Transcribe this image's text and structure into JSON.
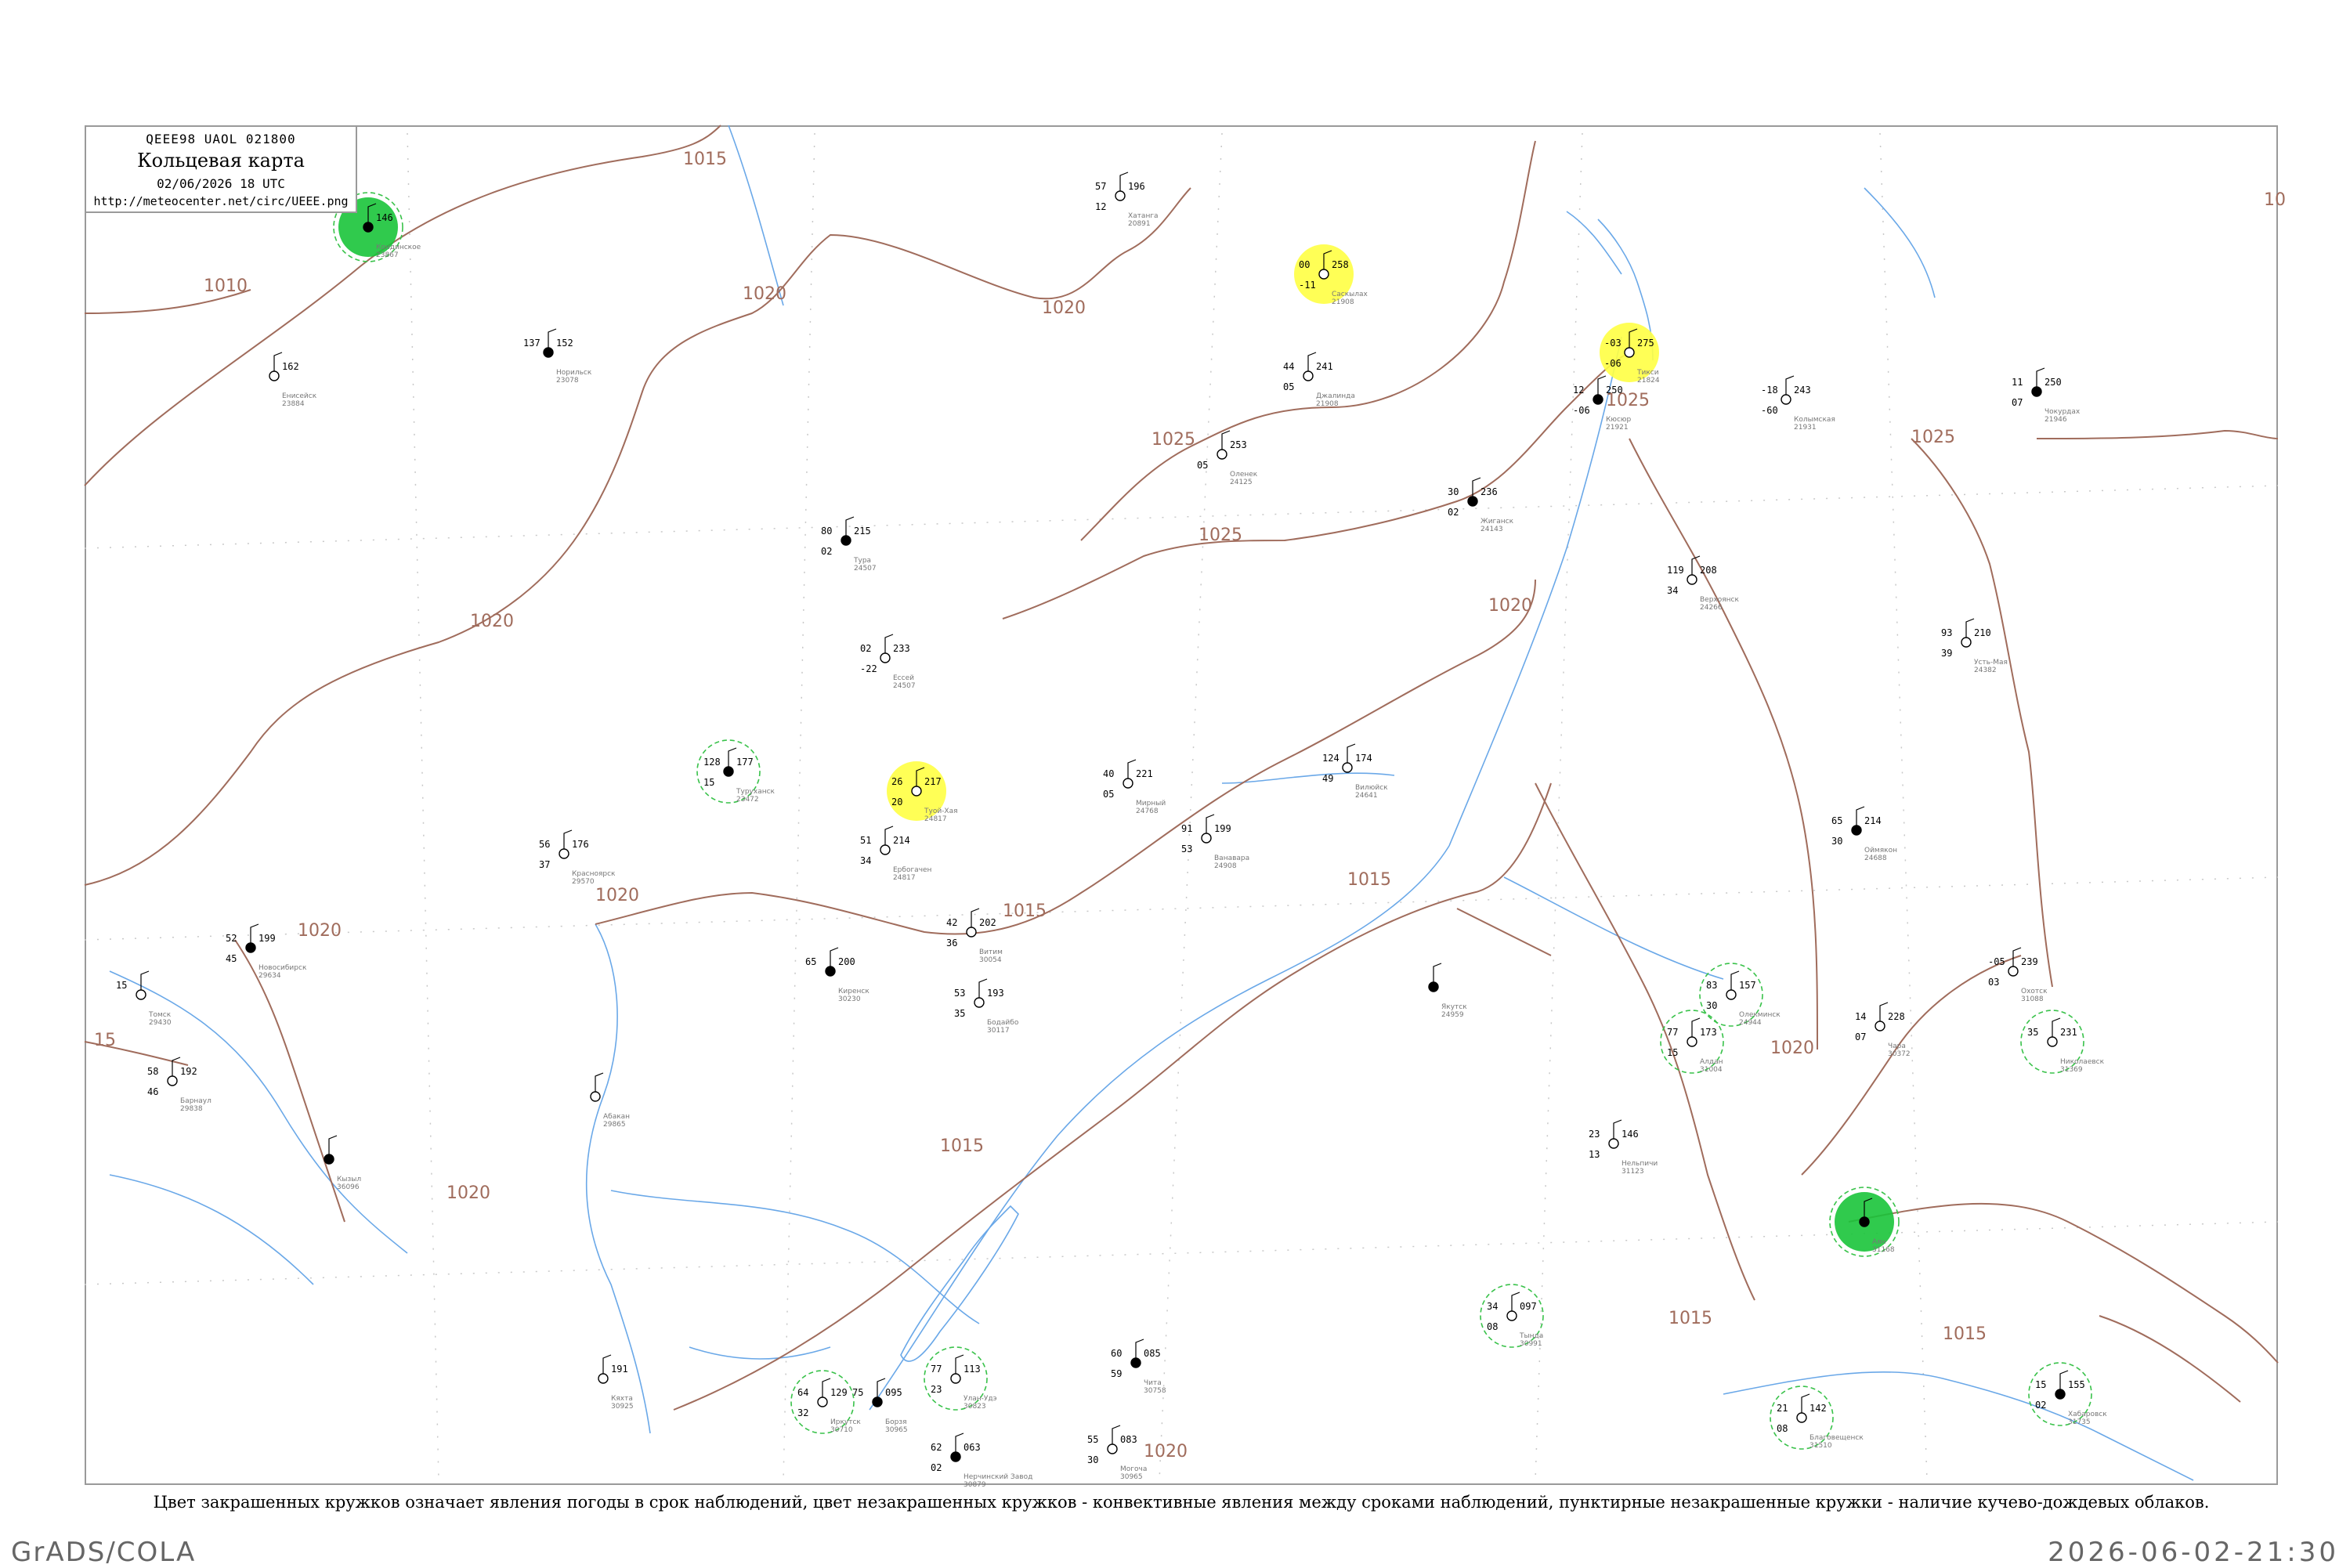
{
  "legend": {
    "code": "QEEE98  UAOL  021800",
    "title": "Кольцевая карта",
    "date": "02/06/2026 18 UTC",
    "url": "http://meteocenter.net/circ/UEEE.png"
  },
  "caption": "Цвет закрашенных кружков означает явления погоды в срок наблюдений, цвет незакрашенных кружков - конвективные явления между сроками наблюдений, пунктирные незакрашенные кружки - наличие кучево-дождевых облаков.",
  "footer": {
    "left": "GrADS/COLA",
    "right": "2026-06-02-21:30"
  },
  "colors": {
    "isobar": "#a06c5c",
    "water": "#6aa8e8",
    "fill_precip": "#19c43a",
    "fill_light": "#5ee07a",
    "fill_fog": "#ffff44",
    "fill_haze": "#f7c064",
    "ring_cb": "#39c24a",
    "ring_thunder": "#d04040"
  },
  "isobar_labels": [
    "1015",
    "1010",
    "1020",
    "1020",
    "1025",
    "1020",
    "1025",
    "1020",
    "1020",
    "1020",
    "1015",
    "1015",
    "1025",
    "1015",
    "1020",
    "1020",
    "1015",
    "1015",
    "1020",
    "1025",
    "10",
    "15"
  ],
  "stations": [
    {
      "name": "Кондинское",
      "id": "23867",
      "p": "146",
      "t": "",
      "td": "",
      "fill": "precip",
      "ring": "cb"
    },
    {
      "name": "Мирный",
      "id": "24768",
      "p": "221",
      "t": "40",
      "td": "05",
      "fill": "",
      "ring": ""
    },
    {
      "name": "Вилюйск",
      "id": "24641",
      "p": "174",
      "t": "124",
      "td": "49",
      "fill": "",
      "ring": ""
    },
    {
      "name": "Оймякон",
      "id": "24688",
      "p": "214",
      "t": "65",
      "td": "30",
      "fill": "",
      "ring": ""
    },
    {
      "name": "Оленек",
      "id": "24125",
      "p": "253",
      "t": "",
      "td": "05",
      "fill": "",
      "ring": ""
    },
    {
      "name": "Ванавара",
      "id": "24908",
      "p": "199",
      "t": "91",
      "td": "53",
      "fill": "",
      "ring": ""
    },
    {
      "name": "Туруханск",
      "id": "23472",
      "p": "177",
      "t": "128",
      "td": "15",
      "fill": "",
      "ring": "cb"
    },
    {
      "name": "Саскылах",
      "id": "21908",
      "p": "258",
      "t": "00",
      "td": "-11",
      "fill": "fog",
      "ring": ""
    },
    {
      "name": "Джалинда",
      "id": "21908",
      "p": "241",
      "t": "44",
      "td": "05",
      "fill": "",
      "ring": ""
    },
    {
      "name": "Жиганск",
      "id": "24143",
      "p": "236",
      "t": "30",
      "td": "02",
      "fill": "",
      "ring": ""
    },
    {
      "name": "Верхоянск",
      "id": "24266",
      "p": "208",
      "t": "119",
      "td": "34",
      "fill": "",
      "ring": ""
    },
    {
      "name": "Усть-Мая",
      "id": "24382",
      "p": "210",
      "t": "93",
      "td": "39",
      "fill": "",
      "ring": ""
    },
    {
      "name": "Якутск",
      "id": "24959",
      "p": "",
      "t": "",
      "td": "",
      "fill": "",
      "ring": ""
    },
    {
      "name": "Олекминск",
      "id": "24944",
      "p": "157",
      "t": "83",
      "td": "30",
      "fill": "",
      "ring": "cb"
    },
    {
      "name": "Алдан",
      "id": "31004",
      "p": "173",
      "t": "77",
      "td": "15",
      "fill": "",
      "ring": "cb"
    },
    {
      "name": "Чокурдах",
      "id": "21946",
      "p": "250",
      "t": "11",
      "td": "07",
      "fill": "",
      "ring": ""
    },
    {
      "name": "Колымская",
      "id": "21931",
      "p": "243",
      "t": "-18",
      "td": "-60",
      "fill": "",
      "ring": ""
    },
    {
      "name": "Тикси",
      "id": "21824",
      "p": "275",
      "t": "-03",
      "td": "-06",
      "fill": "fog",
      "ring": ""
    },
    {
      "name": "Кюсюр",
      "id": "21921",
      "p": "250",
      "t": "12",
      "td": "-06",
      "fill": "",
      "ring": ""
    },
    {
      "name": "Чара",
      "id": "30372",
      "p": "228",
      "t": "14",
      "td": "07",
      "fill": "",
      "ring": ""
    },
    {
      "name": "Витим",
      "id": "30054",
      "p": "202",
      "t": "42",
      "td": "36",
      "fill": "",
      "ring": ""
    },
    {
      "name": "Киренск",
      "id": "30230",
      "p": "200",
      "t": "65",
      "td": "",
      "fill": "",
      "ring": ""
    },
    {
      "name": "Бодайбо",
      "id": "30117",
      "p": "193",
      "t": "53",
      "td": "35",
      "fill": "",
      "ring": ""
    },
    {
      "name": "Могоча",
      "id": "30965",
      "p": "083",
      "t": "55",
      "td": "30",
      "fill": "",
      "ring": ""
    },
    {
      "name": "Чита",
      "id": "30758",
      "p": "085",
      "t": "60",
      "td": "59",
      "fill": "",
      "ring": ""
    },
    {
      "name": "Иркутск",
      "id": "30710",
      "p": "129",
      "t": "64",
      "td": "32",
      "fill": "",
      "ring": "cb"
    },
    {
      "name": "Улан-Удэ",
      "id": "30823",
      "p": "113",
      "t": "77",
      "td": "23",
      "fill": "",
      "ring": "cb"
    },
    {
      "name": "Нерчинский Завод",
      "id": "30879",
      "p": "063",
      "t": "62",
      "td": "02",
      "fill": "",
      "ring": ""
    },
    {
      "name": "Тында",
      "id": "30991",
      "p": "097",
      "t": "34",
      "td": "08",
      "fill": "",
      "ring": "cb"
    },
    {
      "name": "Благовещенск",
      "id": "31510",
      "p": "142",
      "t": "21",
      "td": "08",
      "fill": "",
      "ring": "cb"
    },
    {
      "name": "Хабаровск",
      "id": "31735",
      "p": "155",
      "t": "15",
      "td": "02",
      "fill": "",
      "ring": "cb"
    },
    {
      "name": "Николаевск",
      "id": "31369",
      "p": "231",
      "t": "35",
      "td": "",
      "fill": "",
      "ring": "cb"
    },
    {
      "name": "Охотск",
      "id": "31088",
      "p": "239",
      "t": "-05",
      "td": "03",
      "fill": "",
      "ring": ""
    },
    {
      "name": "Аян",
      "id": "31168",
      "p": "",
      "t": "",
      "td": "",
      "fill": "precip",
      "ring": "cb"
    },
    {
      "name": "Нельпичи",
      "id": "31123",
      "p": "146",
      "t": "23",
      "td": "13",
      "fill": "",
      "ring": ""
    },
    {
      "name": "Томск",
      "id": "29430",
      "p": "",
      "t": "15",
      "td": "",
      "fill": "",
      "ring": ""
    },
    {
      "name": "Новосибирск",
      "id": "29634",
      "p": "199",
      "t": "52",
      "td": "45",
      "fill": "",
      "ring": ""
    },
    {
      "name": "Барнаул",
      "id": "29838",
      "p": "192",
      "t": "58",
      "td": "46",
      "fill": "",
      "ring": ""
    },
    {
      "name": "Красноярск",
      "id": "29570",
      "p": "176",
      "t": "56",
      "td": "37",
      "fill": "",
      "ring": ""
    },
    {
      "name": "Кызыл",
      "id": "36096",
      "p": "",
      "t": "",
      "td": "",
      "fill": "",
      "ring": ""
    },
    {
      "name": "Абакан",
      "id": "29865",
      "p": "",
      "t": "",
      "td": "",
      "fill": "",
      "ring": ""
    },
    {
      "name": "Енисейск",
      "id": "23884",
      "p": "162",
      "t": "",
      "td": "",
      "fill": "",
      "ring": ""
    },
    {
      "name": "Тура",
      "id": "24507",
      "p": "215",
      "t": "80",
      "td": "02",
      "fill": "",
      "ring": ""
    },
    {
      "name": "Ессей",
      "id": "24507",
      "p": "233",
      "t": "02",
      "td": "-22",
      "fill": "",
      "ring": ""
    },
    {
      "name": "Хатанга",
      "id": "20891",
      "p": "196",
      "t": "57",
      "td": "12",
      "fill": "",
      "ring": ""
    },
    {
      "name": "Норильск",
      "id": "23078",
      "p": "152",
      "t": "137",
      "td": "",
      "fill": "",
      "ring": ""
    },
    {
      "name": "Туой-Хая",
      "id": "24817",
      "p": "217",
      "t": "26",
      "td": "20",
      "fill": "fog",
      "ring": ""
    },
    {
      "name": "Ербогачен",
      "id": "24817",
      "p": "214",
      "t": "51",
      "td": "34",
      "fill": "",
      "ring": ""
    },
    {
      "name": "Борзя",
      "id": "30965",
      "p": "095",
      "t": "75",
      "td": "",
      "fill": "",
      "ring": ""
    },
    {
      "name": "Кяхта",
      "id": "30925",
      "p": "191",
      "t": "",
      "td": "",
      "fill": "",
      "ring": ""
    }
  ]
}
